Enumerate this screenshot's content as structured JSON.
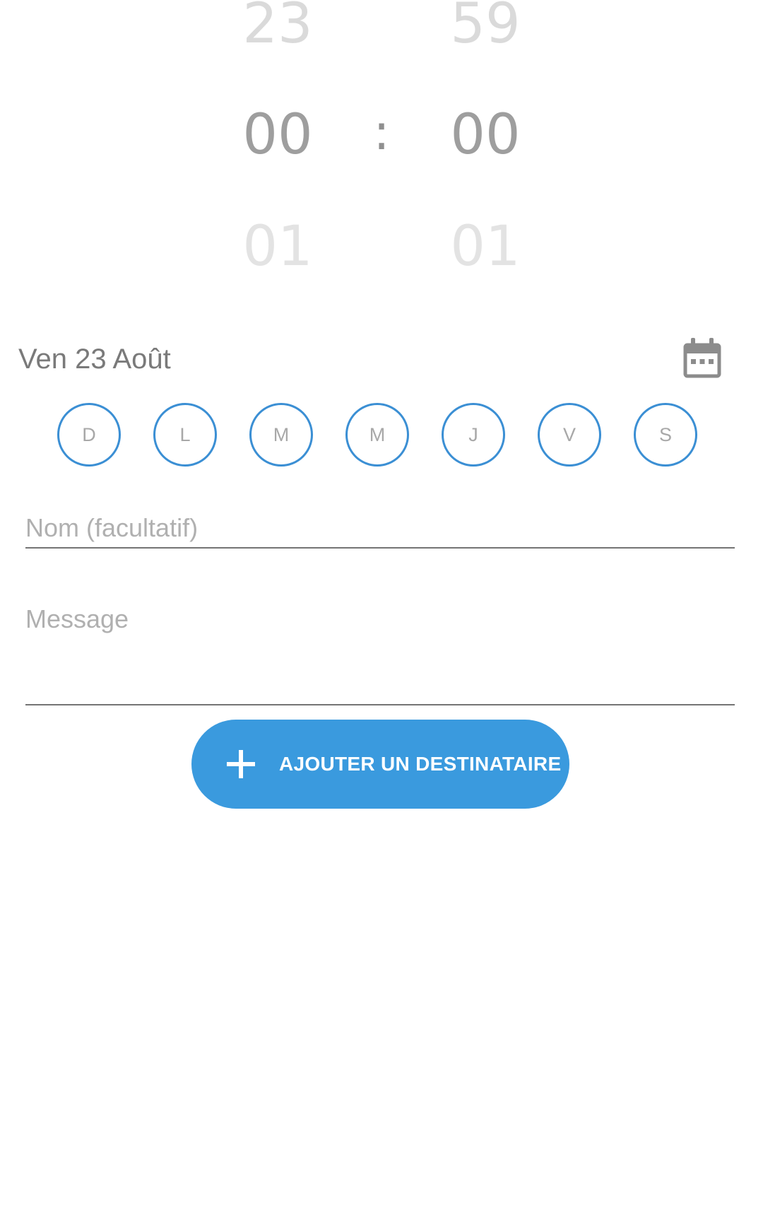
{
  "time_picker": {
    "hours": {
      "prev": "23",
      "current": "00",
      "next": "01"
    },
    "separator": ":",
    "minutes": {
      "prev": "59",
      "current": "00",
      "next": "01"
    }
  },
  "date": {
    "label": "Ven 23 Août",
    "calendar_icon": "calendar-icon"
  },
  "days": [
    "D",
    "L",
    "M",
    "M",
    "J",
    "V",
    "S"
  ],
  "form": {
    "name_placeholder": "Nom (facultatif)",
    "name_value": "",
    "message_placeholder": "Message",
    "message_value": ""
  },
  "add_recipient": {
    "label": "AJOUTER UN DESTINATAIRE",
    "icon": "plus-icon"
  },
  "colors": {
    "accent": "#3a9ade",
    "day_circle_border": "#3b8fd4",
    "text_muted": "#7a7a7a"
  }
}
